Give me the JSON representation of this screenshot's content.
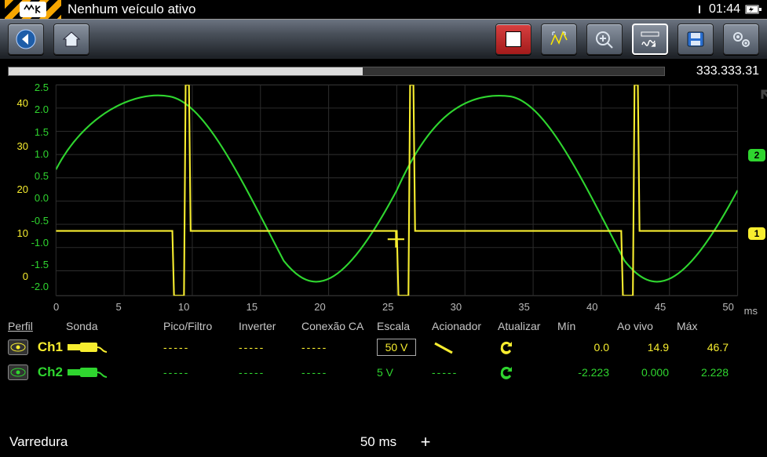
{
  "status": {
    "title": "Nenhum veículo ativo",
    "clock": "01:44",
    "battery_level": 100
  },
  "toolbar": {
    "back": "back-button",
    "home": "home-button",
    "record": "record-button",
    "pause": "cursor-measure-button",
    "zoom": "zoom-button",
    "graph": "wave-settings-button",
    "save": "save-button",
    "settings": "settings-button"
  },
  "counter": "333.333.31",
  "scope": {
    "y_left": [
      "",
      "40",
      "",
      "30",
      "",
      "20",
      "",
      "10",
      "",
      "0",
      ""
    ],
    "y_right": [
      "2.5",
      "",
      "2.0",
      "",
      "1.5",
      "",
      "1.0",
      "",
      "0.5",
      "",
      "0.0",
      "",
      "-0.5",
      "",
      "-1.0",
      "",
      "-1.5",
      "",
      "-2.0",
      ""
    ],
    "x_axis": [
      "0",
      "5",
      "10",
      "15",
      "20",
      "25",
      "30",
      "35",
      "40",
      "45",
      "50"
    ],
    "x_unit": "ms",
    "ch_flags": {
      "ch1": "1",
      "ch2": "2"
    }
  },
  "columns": {
    "perfil": "Perfil",
    "sonda": "Sonda",
    "pico": "Pico/Filtro",
    "inverter": "Inverter",
    "conexao": "Conexão CA",
    "escala": "Escala",
    "acionador": "Acionador",
    "atualizar": "Atualizar",
    "min": "Mín",
    "aovivo": "Ao vivo",
    "max": "Máx"
  },
  "channels": [
    {
      "id": "Ch1",
      "color": "#f7ed2f",
      "sonda": "probe",
      "pico": "-----",
      "inverter": "-----",
      "conexao": "-----",
      "escala": "50 V",
      "acionador": "slope",
      "min": "0.0",
      "aovivo": "14.9",
      "max": "46.7"
    },
    {
      "id": "Ch2",
      "color": "#2fd52f",
      "sonda": "probe",
      "pico": "-----",
      "inverter": "-----",
      "conexao": "-----",
      "escala": "5 V",
      "acionador": "-----",
      "min": "-2.223",
      "aovivo": "0.000",
      "max": "2.228"
    }
  ],
  "sweep": {
    "label": "Varredura",
    "value": "50 ms",
    "plus": "+"
  },
  "chart_data": {
    "type": "line",
    "xlabel": "ms",
    "xlim": [
      0,
      50
    ],
    "series": [
      {
        "name": "Ch2 (green sine)",
        "ylim": [
          -2.5,
          2.5
        ],
        "color": "#2fd52f",
        "note": "continuous sine, period≈16.6ms, amplitude≈2.25",
        "values_sampled_every_2ms": [
          0.49,
          1.29,
          1.94,
          2.23,
          2.08,
          1.52,
          0.67,
          -0.31,
          -1.22,
          -1.93,
          -2.25,
          -2.11,
          -1.55,
          -0.7,
          0.28,
          1.2,
          1.92,
          2.25,
          2.12,
          1.58,
          0.73,
          -0.25,
          -1.17,
          -1.9,
          -2.25,
          -2.13
        ]
      },
      {
        "name": "Ch1 (yellow pulse)",
        "ylim": [
          0,
          50
        ],
        "color": "#f7ed2f",
        "note": "baseline ≈15V, narrow spikes to ~47V at ~9.5/26/42.5 ms preceded by dip to ~0V",
        "baseline": 15,
        "spike_ms": [
          9.5,
          26.0,
          42.5
        ],
        "spike_peak": 47,
        "predip": 0
      }
    ]
  }
}
